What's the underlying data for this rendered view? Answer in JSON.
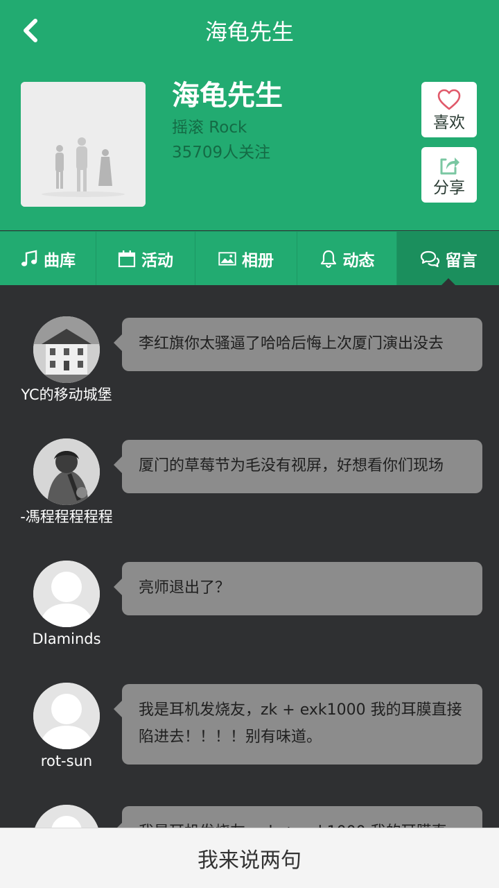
{
  "topbar": {
    "title": "海龟先生",
    "back_icon": "chevron-left-icon"
  },
  "artist": {
    "name": "海龟先生",
    "genre": "摇滚 Rock",
    "followers": "35709人关注"
  },
  "actions": {
    "like_label": "喜欢",
    "share_label": "分享"
  },
  "tabs": [
    {
      "label": "曲库",
      "icon": "music-note-icon"
    },
    {
      "label": "活动",
      "icon": "calendar-icon"
    },
    {
      "label": "相册",
      "icon": "image-icon"
    },
    {
      "label": "动态",
      "icon": "bell-icon"
    },
    {
      "label": "留言",
      "icon": "chat-bubbles-icon"
    }
  ],
  "active_tab": "留言",
  "messages": [
    {
      "user": "YC的移动城堡",
      "text": "李红旗你太骚逼了哈哈后悔上次厦门演出没去"
    },
    {
      "user": "-馮程程程程程",
      "text": "厦门的草莓节为毛没有视屏，好想看你们现场"
    },
    {
      "user": "DIaminds",
      "text": "亮师退出了？"
    },
    {
      "user": "rot-sun",
      "text": "我是耳机发烧友，zk + exk1000 我的耳膜直接陷进去！！！！别有味道。"
    },
    {
      "user": "",
      "text": "我是耳机发烧友，zk + exk1000 我的耳膜直"
    }
  ],
  "bottom": {
    "label": "我来说两句"
  },
  "colors": {
    "brand": "#22ab71",
    "tab_active": "#1b8f5d",
    "background": "#2f3032",
    "bubble": "#8c8c8c",
    "like_heart": "#e0596a"
  }
}
